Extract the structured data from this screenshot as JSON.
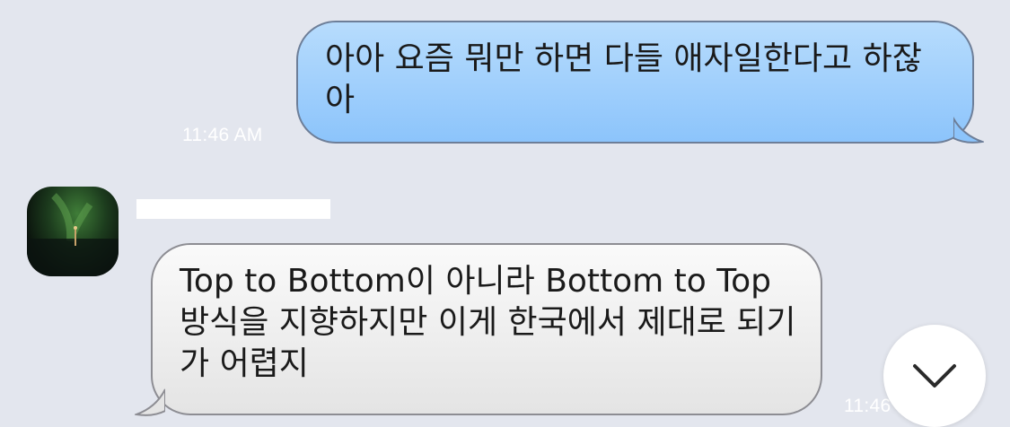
{
  "messages": {
    "outgoing": {
      "text": "아아 요즘 뭐만 하면 다들 애자일한다고 하잖아",
      "time": "11:46 AM"
    },
    "incoming": {
      "sender": "",
      "text": "Top to Bottom이 아니라 Bottom to Top 방식을 지향하지만 이게 한국에서 제대로 되기가 어렵지",
      "time": "11:46"
    }
  },
  "colors": {
    "background": "#e3e6ee",
    "outgoing_bubble": "#9fd0fc",
    "incoming_bubble": "#f2f2f2"
  },
  "icons": {
    "scroll_down": "chevron-down-icon"
  }
}
